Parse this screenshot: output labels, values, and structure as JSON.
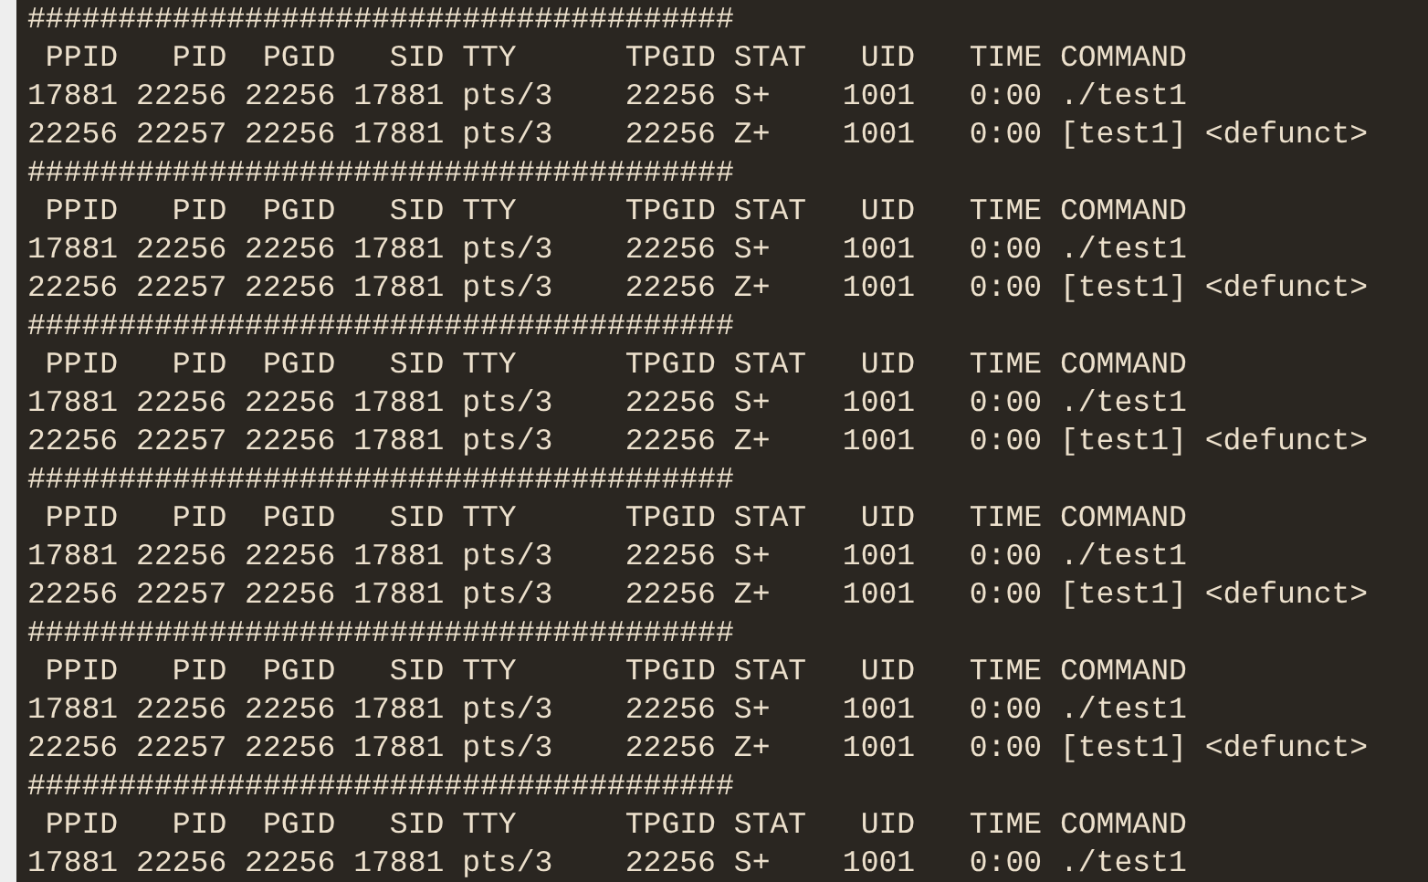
{
  "terminal": {
    "lines": [
      "#######################################",
      " PPID   PID  PGID   SID TTY      TPGID STAT   UID   TIME COMMAND",
      "17881 22256 22256 17881 pts/3    22256 S+    1001   0:00 ./test1",
      "22256 22257 22256 17881 pts/3    22256 Z+    1001   0:00 [test1] <defunct>",
      "#######################################",
      " PPID   PID  PGID   SID TTY      TPGID STAT   UID   TIME COMMAND",
      "17881 22256 22256 17881 pts/3    22256 S+    1001   0:00 ./test1",
      "22256 22257 22256 17881 pts/3    22256 Z+    1001   0:00 [test1] <defunct>",
      "#######################################",
      " PPID   PID  PGID   SID TTY      TPGID STAT   UID   TIME COMMAND",
      "17881 22256 22256 17881 pts/3    22256 S+    1001   0:00 ./test1",
      "22256 22257 22256 17881 pts/3    22256 Z+    1001   0:00 [test1] <defunct>",
      "#######################################",
      " PPID   PID  PGID   SID TTY      TPGID STAT   UID   TIME COMMAND",
      "17881 22256 22256 17881 pts/3    22256 S+    1001   0:00 ./test1",
      "22256 22257 22256 17881 pts/3    22256 Z+    1001   0:00 [test1] <defunct>",
      "#######################################",
      " PPID   PID  PGID   SID TTY      TPGID STAT   UID   TIME COMMAND",
      "17881 22256 22256 17881 pts/3    22256 S+    1001   0:00 ./test1",
      "22256 22257 22256 17881 pts/3    22256 Z+    1001   0:00 [test1] <defunct>",
      "#######################################",
      " PPID   PID  PGID   SID TTY      TPGID STAT   UID   TIME COMMAND",
      "17881 22256 22256 17881 pts/3    22256 S+    1001   0:00 ./test1"
    ]
  }
}
